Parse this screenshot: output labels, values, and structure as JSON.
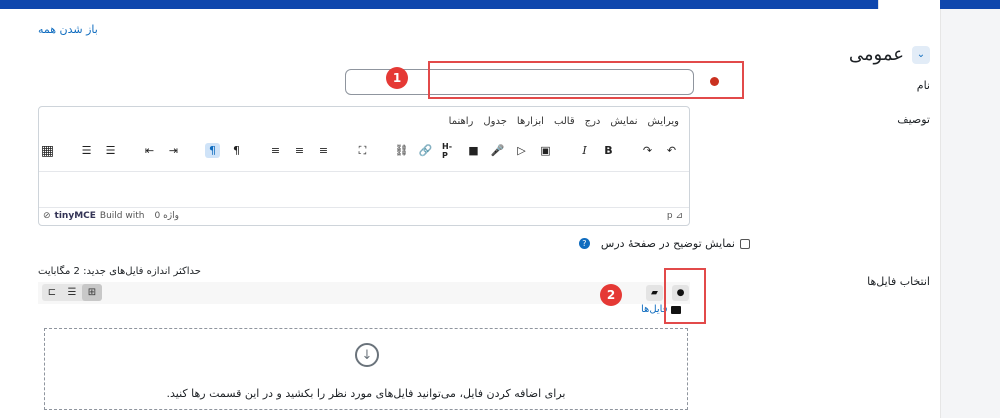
{
  "section": {
    "title": "عمومی",
    "expand_all": "باز شدن همه"
  },
  "labels": {
    "name": "نام",
    "description": "توصیف",
    "files": "انتخاب فایل‌ها"
  },
  "name_field": {
    "value": ""
  },
  "editor": {
    "menu": [
      "ویرایش",
      "نمایش",
      "درج",
      "قالب",
      "ابزارها",
      "جدول",
      "راهنما"
    ],
    "brand": "tinyMCE",
    "built_with": "Build with",
    "word_count": "0 واژه",
    "path": "p",
    "toolbar_glyphs": [
      "↶",
      "↷",
      "B",
      "I",
      "▣",
      "▷",
      "🎤",
      "■",
      "H-P",
      "🔗",
      "⛓",
      "⛶",
      "≡",
      "≡",
      "≡",
      "¶",
      "¶",
      "⇥",
      "⇤",
      "☰",
      "☰",
      "▦"
    ]
  },
  "show_description": "نمایش توضیح در صفحهٔ درس",
  "filepicker": {
    "max_size": "حداکثر اندازه فایل‌های جدید: 2 مگابایت",
    "crumb": "فایل‌ها",
    "drop_text": "برای اضافه کردن فایل، می‌توانید فایل‌های مورد نظر را بکشید و در این قسمت رها کنید."
  },
  "annotations": {
    "one": "1",
    "two": "2"
  },
  "colors": {
    "accent": "#0f6cbf",
    "topbar": "#0f47ad",
    "highlight": "#e24a4a",
    "badge": "#e53935",
    "required": "#ca3120"
  }
}
